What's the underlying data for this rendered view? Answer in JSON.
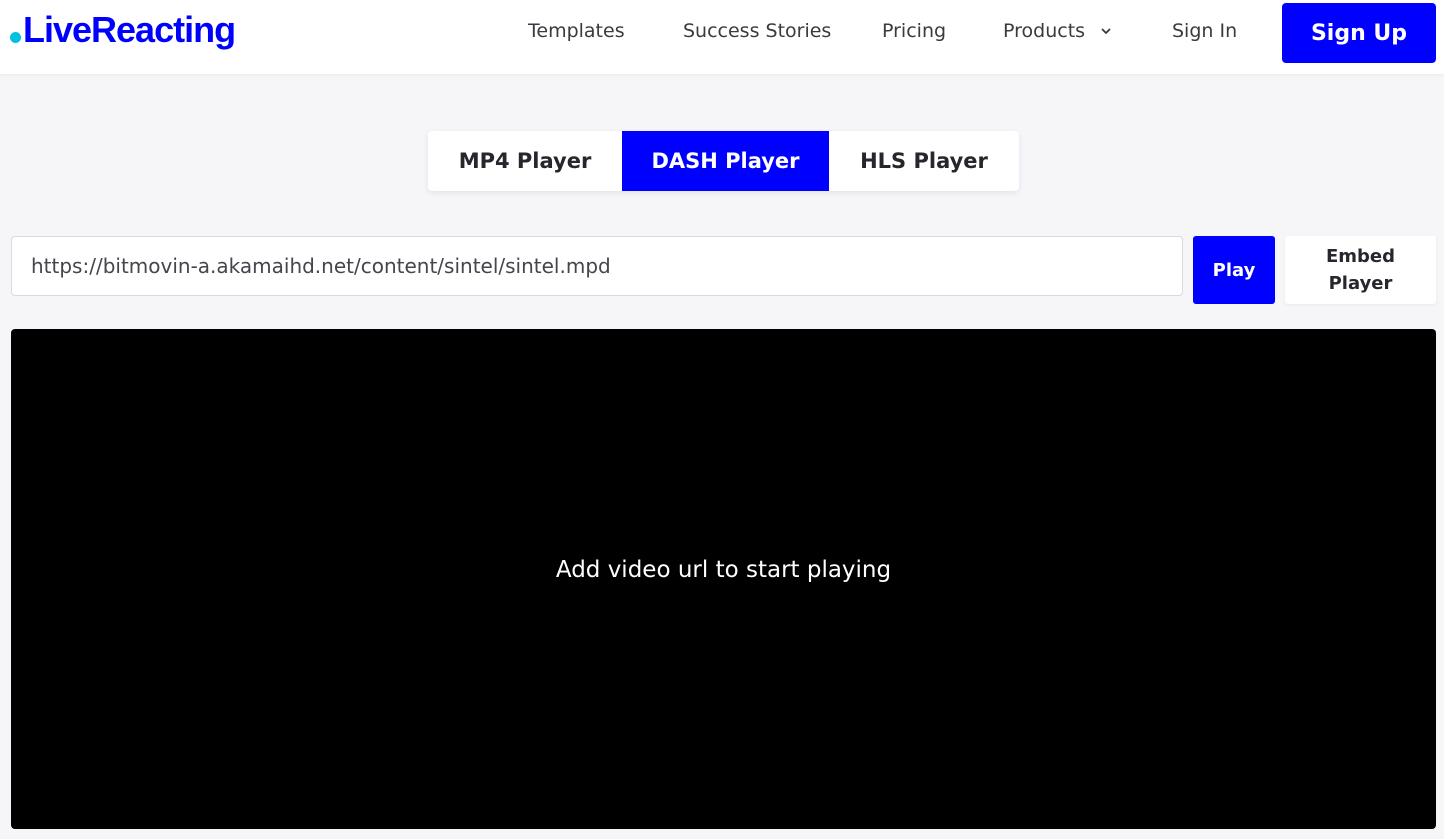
{
  "brand": {
    "name": "LiveReacting",
    "dot_color": "#00c2e0",
    "accent": "#0000ff"
  },
  "nav": {
    "links": [
      {
        "label": "Templates"
      },
      {
        "label": "Success Stories"
      },
      {
        "label": "Pricing"
      },
      {
        "label": "Products",
        "icon": "chevron-down-icon"
      },
      {
        "label": "Sign In"
      }
    ],
    "signup_label": "Sign Up"
  },
  "tabs": [
    {
      "label": "MP4 Player",
      "active": false
    },
    {
      "label": "DASH Player",
      "active": true
    },
    {
      "label": "HLS Player",
      "active": false
    }
  ],
  "player": {
    "url_value": "https://bitmovin-a.akamaihd.net/content/sintel/sintel.mpd",
    "play_label": "Play",
    "embed_label": "Embed\nPlayer",
    "placeholder_message": "Add video url to start playing",
    "video_background": "#000000"
  }
}
